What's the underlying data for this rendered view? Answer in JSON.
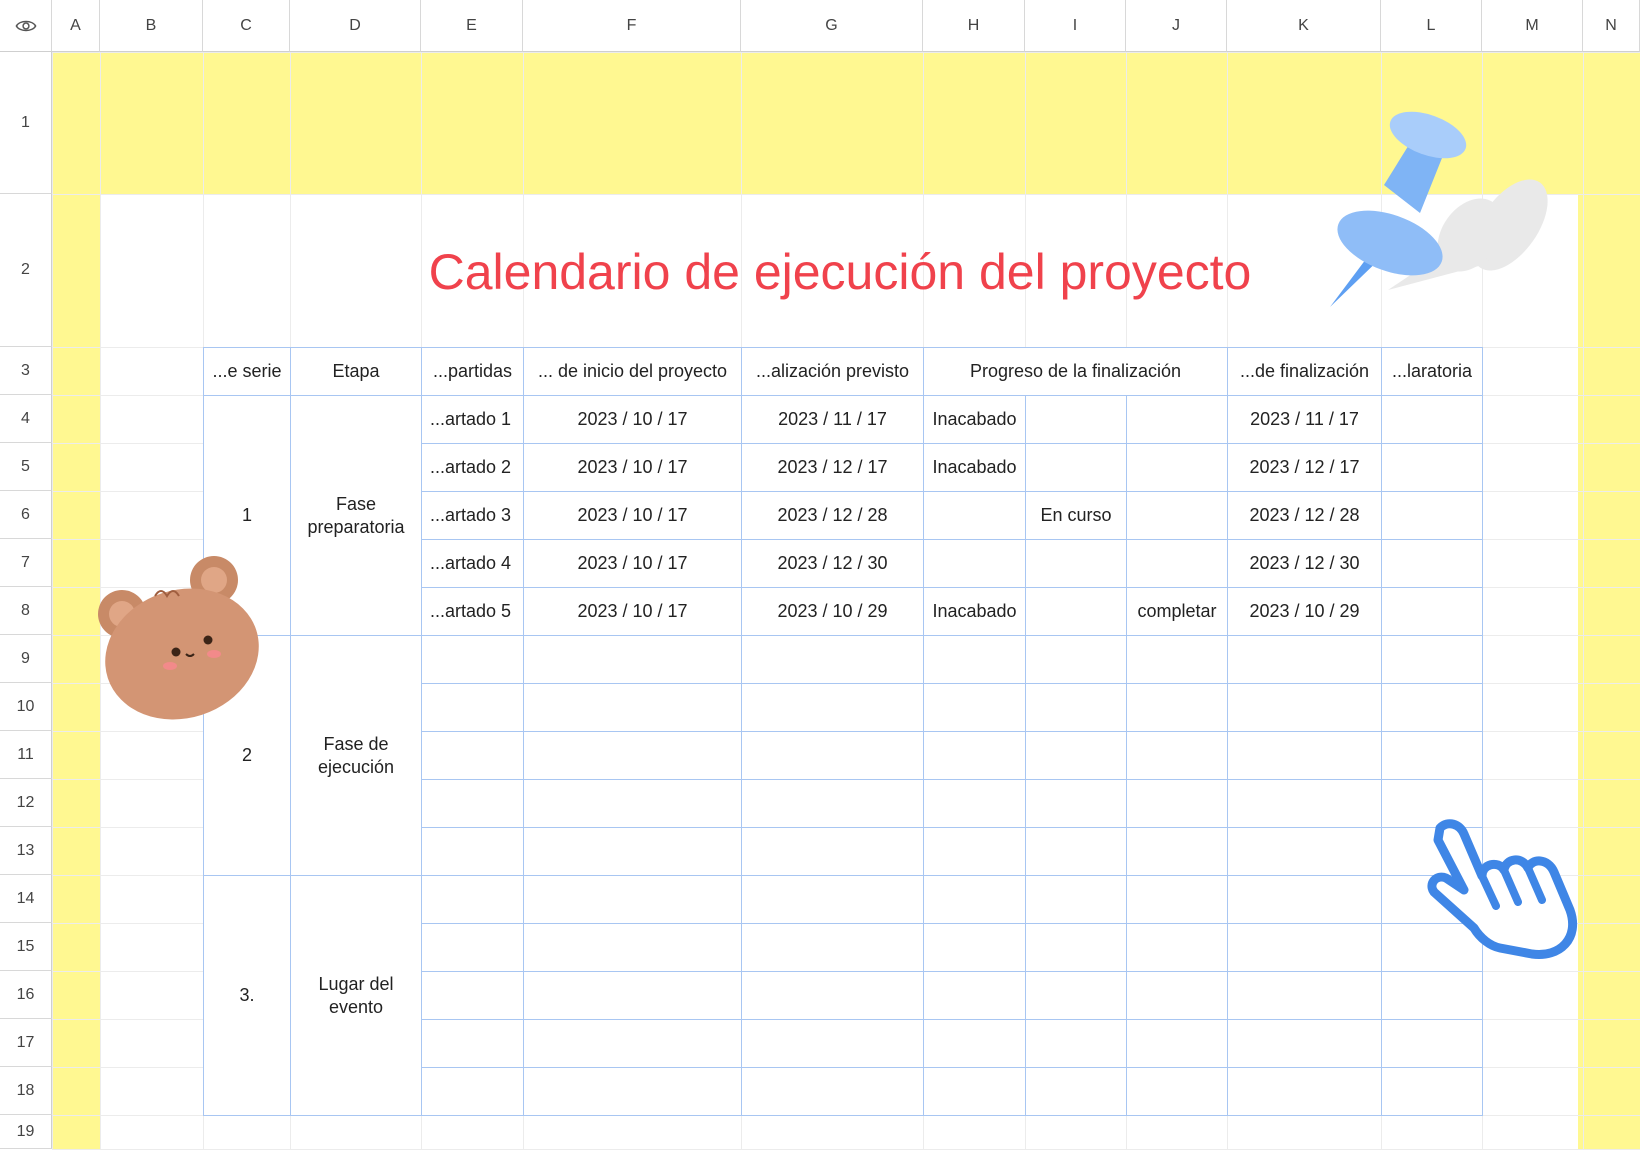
{
  "sheet": {
    "columns": [
      "A",
      "B",
      "C",
      "D",
      "E",
      "F",
      "G",
      "H",
      "I",
      "J",
      "K",
      "L",
      "M",
      "N"
    ],
    "rows": [
      "1",
      "2",
      "3",
      "4",
      "5",
      "6",
      "7",
      "8",
      "9",
      "10",
      "11",
      "12",
      "13",
      "14",
      "15",
      "16",
      "17",
      "18",
      "19"
    ],
    "corner_icon": "eye-icon"
  },
  "title": "Calendario de ejecución del proyecto",
  "table": {
    "headers": {
      "serie": "...e serie",
      "etapa": "Etapa",
      "partidas": "...partidas",
      "inicio": "... de inicio del proyecto",
      "previsto": "...alización previsto",
      "progreso": "Progreso de la finalización",
      "finalizacion": "...de finalización",
      "aclaratoria": "...laratoria"
    },
    "groups": [
      {
        "serie": "1",
        "etapa": "Fase preparatoria"
      },
      {
        "serie": "2",
        "etapa": "Fase de ejecución"
      },
      {
        "serie": "3.",
        "etapa": "Lugar del evento"
      }
    ],
    "rows": [
      {
        "partida": "...artado 1",
        "inicio": "2023 / 10 / 17",
        "previsto": "2023 / 11 / 17",
        "h": "Inacabado",
        "i": "",
        "j": "",
        "fin": "2023 / 11 / 17",
        "nota": ""
      },
      {
        "partida": "...artado 2",
        "inicio": "2023 / 10 / 17",
        "previsto": "2023 / 12 / 17",
        "h": "Inacabado",
        "i": "",
        "j": "",
        "fin": "2023 / 12 / 17",
        "nota": ""
      },
      {
        "partida": "...artado 3",
        "inicio": "2023 / 10 / 17",
        "previsto": "2023 / 12 / 28",
        "h": "",
        "i": "En curso",
        "j": "",
        "fin": "2023 / 12 / 28",
        "nota": ""
      },
      {
        "partida": "...artado 4",
        "inicio": "2023 / 10 / 17",
        "previsto": "2023 / 12 / 30",
        "h": "",
        "i": "",
        "j": "",
        "fin": "2023 / 12 / 30",
        "nota": ""
      },
      {
        "partida": "...artado 5",
        "inicio": "2023 / 10 / 17",
        "previsto": "2023 / 10 / 29",
        "h": "Inacabado",
        "i": "",
        "j": "completar",
        "fin": "2023 / 10 / 29",
        "nota": ""
      }
    ]
  },
  "stickers": [
    "pushpin-icon",
    "bear-icon",
    "pointing-hand-icon"
  ],
  "colors": {
    "title": "#f0424c",
    "frame": "#fff891",
    "table_border": "#a8c6f2",
    "hand": "#3f86e6",
    "pin": "#7fb4f5",
    "bear": "#d39574"
  }
}
